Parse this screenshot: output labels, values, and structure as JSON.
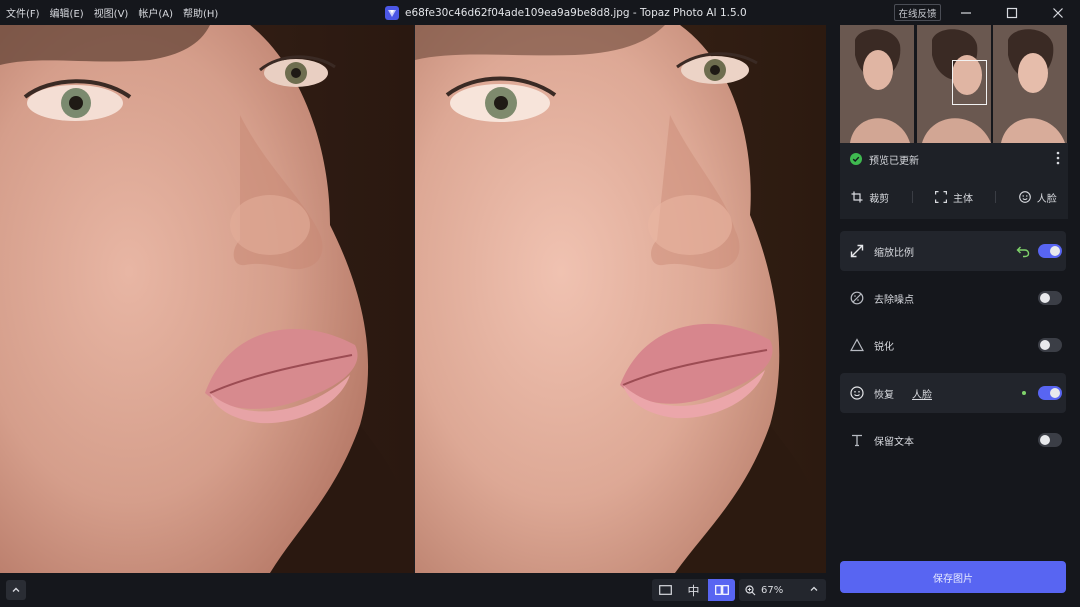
{
  "menu": {
    "items": [
      "文件(F)",
      "编辑(E)",
      "视图(V)",
      "帐户(A)",
      "帮助(H)"
    ]
  },
  "window": {
    "title": "e68fe30c46d62f04ade109ea9a9be8d8.jpg - Topaz Photo AI 1.5.0",
    "feedback_label": "在线反馈"
  },
  "panel": {
    "preview_status": "预览已更新",
    "tools": [
      {
        "label": "裁剪",
        "icon": "crop-icon"
      },
      {
        "label": "主体",
        "icon": "subject-icon"
      },
      {
        "label": "人脸",
        "icon": "face-icon"
      }
    ],
    "features": [
      {
        "label": "缩放比例",
        "icon": "resize-icon",
        "enabled": true
      },
      {
        "label": "去除噪点",
        "icon": "denoise-icon",
        "enabled": false
      },
      {
        "label": "锐化",
        "icon": "sharpen-icon",
        "enabled": false
      },
      {
        "label": "恢复",
        "sublabel": "人脸",
        "icon": "face-recovery-icon",
        "enabled": true
      },
      {
        "label": "保留文本",
        "icon": "text-icon",
        "enabled": false
      }
    ],
    "save_label": "保存图片"
  },
  "bottom": {
    "view_modes": [
      {
        "icon": "single-view-icon",
        "active": false
      },
      {
        "label": "中",
        "icon": "split-view-icon",
        "active": false
      },
      {
        "icon": "side-by-side-view-icon",
        "active": true
      }
    ],
    "zoom_level": "67%"
  },
  "colors": {
    "accent": "#5865f2",
    "panel_bg": "#15171c",
    "success": "#3fb950",
    "undo": "#7fd36b"
  }
}
